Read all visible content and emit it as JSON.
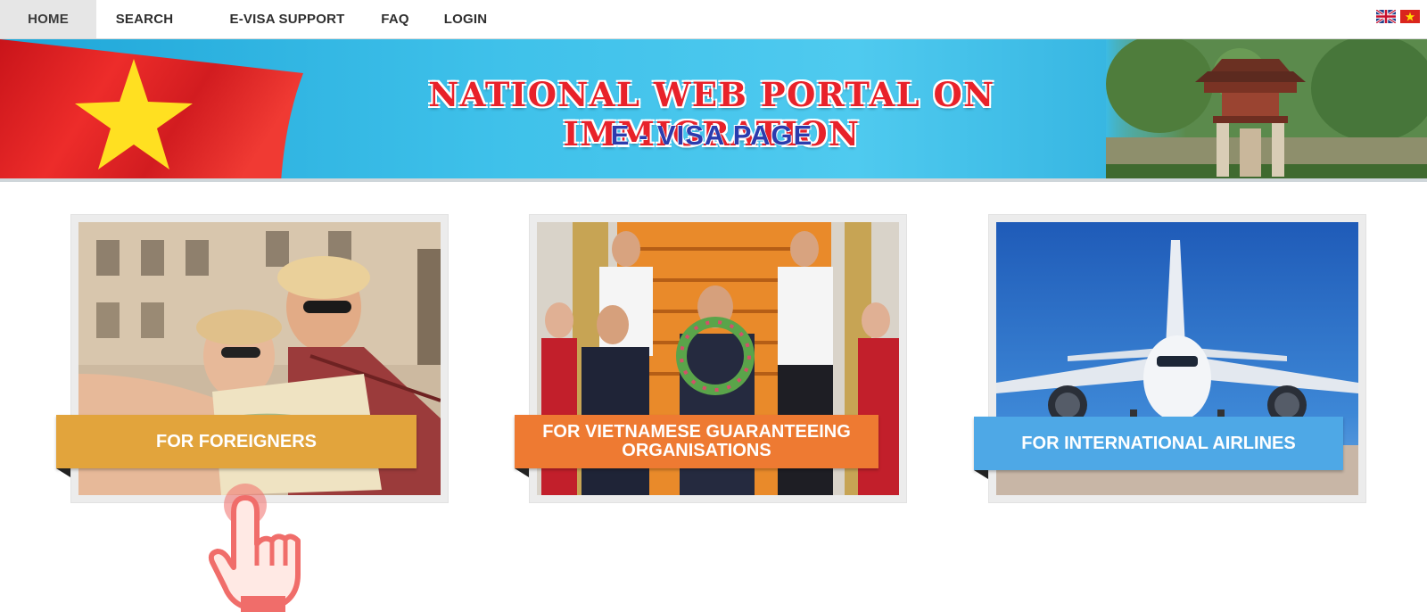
{
  "nav": {
    "items": [
      {
        "label": "HOME",
        "active": true
      },
      {
        "label": "SEARCH",
        "active": false
      },
      {
        "label": "E-VISA SUPPORT",
        "active": false
      },
      {
        "label": "FAQ",
        "active": false
      },
      {
        "label": "LOGIN",
        "active": false
      }
    ],
    "languages": [
      "uk-flag-icon",
      "vietnam-flag-icon"
    ]
  },
  "banner": {
    "title": "NATIONAL WEB PORTAL ON IMMIGRATION",
    "subtitle": "E - VISA PAGE"
  },
  "cards": [
    {
      "label": "FOR FOREIGNERS",
      "color": "#e2a43c",
      "image": "tourists-with-map-photo"
    },
    {
      "label_line1": "FOR VIETNAMESE GUARANTEEING",
      "label_line2": "ORGANISATIONS",
      "color": "#ee7a32",
      "image": "delegation-at-aircraft-stairs-photo"
    },
    {
      "label": "FOR INTERNATIONAL AIRLINES",
      "color": "#4ea8e6",
      "image": "airplane-on-runway-photo"
    }
  ],
  "colors": {
    "flag_red": "#e32b2b",
    "flag_star": "#ffe021",
    "title_red": "#e8222a",
    "subtitle_blue": "#2b3cae",
    "hand_pointer": "#f06d6a"
  }
}
